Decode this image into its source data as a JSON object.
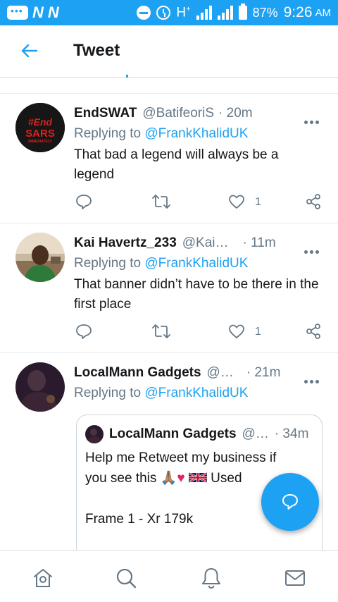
{
  "status_bar": {
    "carrier_1": "N",
    "carrier_2": "N",
    "network": "H",
    "network_sup": "+",
    "battery": "87%",
    "time": "9:26",
    "ampm": "AM"
  },
  "header": {
    "title": "Tweet"
  },
  "tweets": [
    {
      "name": "EndSWAT",
      "handle": "@BatifeoriS",
      "time": "· 20m",
      "replying_prefix": "Replying to ",
      "replying_to": "@FrankKhalidUK",
      "text": "That bad a legend will always be a legend",
      "avatar_text_1": "#End",
      "avatar_text_2": "SARS",
      "avatar_text_3": "IMMEDIATELY",
      "likes": "1"
    },
    {
      "name": "Kai Havertz_233",
      "handle": "@Kai…",
      "time": "· 11m",
      "replying_prefix": "Replying to ",
      "replying_to": "@FrankKhalidUK",
      "text": "That banner didn’t have to be there in the first place",
      "likes": "1"
    },
    {
      "name": "LocalMann Gadgets",
      "handle": "@…",
      "time": "· 21m",
      "replying_prefix": "Replying to ",
      "replying_to": "@FrankKhalidUK",
      "quote": {
        "name": "LocalMann Gadgets",
        "handle": "@…",
        "time": "· 34m",
        "line_1": "Help me Retweet my business if",
        "line_2_start": "you see this ",
        "praying_emoji": "🙏🏽",
        "heart_emoji": "♥",
        "line_2_end": " Used",
        "line_3": "Frame 1 - Xr 179k"
      }
    }
  ],
  "colors": {
    "accent": "#1da1f2",
    "text": "#14171a",
    "muted": "#657786",
    "heart": "#e0245e"
  },
  "icons": {
    "back": "arrow-left-icon",
    "reply": "reply-icon",
    "retweet": "retweet-icon",
    "like": "heart-icon",
    "share": "share-icon",
    "more": "more-icon",
    "compose": "compose-icon",
    "home": "home-icon",
    "search": "search-icon",
    "notifications": "bell-icon",
    "messages": "mail-icon"
  }
}
